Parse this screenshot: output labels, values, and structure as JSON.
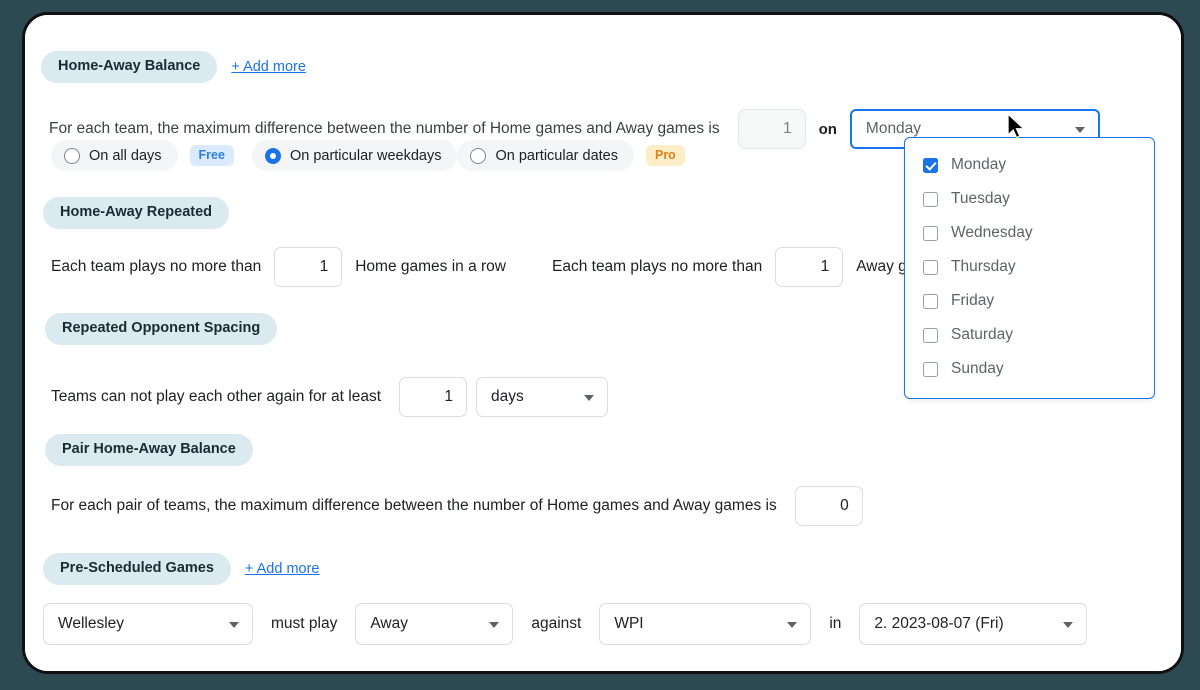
{
  "theme": {
    "page_background": "#2d4a52",
    "card_background": "#ffffff",
    "accent": "#1a73e8",
    "pill_background": "#dbe9f1",
    "free_badge_bg": "#dbeafe",
    "free_badge_fg": "#2f7fe0",
    "pro_badge_bg": "#fdeec8",
    "pro_badge_fg": "#e0801a"
  },
  "sections": {
    "home_away_balance": {
      "title": "Home-Away Balance",
      "add_more": "+ Add more",
      "sentence": "For each team, the maximum difference between the number of Home games and Away games is",
      "max_difference": "1",
      "on_label": "on",
      "weekday_select_value": "Monday",
      "options": [
        {
          "label": "On all days",
          "selected": false,
          "badge": "Free"
        },
        {
          "label": "On particular weekdays",
          "selected": true,
          "badge": ""
        },
        {
          "label": "On particular dates",
          "selected": false,
          "badge": "Pro"
        }
      ],
      "weekday_menu": {
        "open": true,
        "items": [
          {
            "label": "Monday",
            "checked": true
          },
          {
            "label": "Tuesday",
            "checked": false
          },
          {
            "label": "Wednesday",
            "checked": false
          },
          {
            "label": "Thursday",
            "checked": false
          },
          {
            "label": "Friday",
            "checked": false
          },
          {
            "label": "Saturday",
            "checked": false
          },
          {
            "label": "Sunday",
            "checked": false
          }
        ]
      }
    },
    "home_away_repeated": {
      "title": "Home-Away Repeated",
      "home_prefix": "Each team plays no more than",
      "home_value": "1",
      "home_suffix": "Home games in a row",
      "away_prefix": "Each team plays no more than",
      "away_value": "1",
      "away_suffix": "Away games in a row"
    },
    "repeated_opponent_spacing": {
      "title": "Repeated Opponent Spacing",
      "sentence": "Teams can not play each other again for at least",
      "value": "1",
      "unit": "days"
    },
    "pair_home_away_balance": {
      "title": "Pair Home-Away Balance",
      "sentence": "For each pair of teams, the maximum difference between the number of Home games and Away games is",
      "value": "0"
    },
    "pre_scheduled_games": {
      "title": "Pre-Scheduled Games",
      "add_more": "+ Add more",
      "team": "Wellesley",
      "must_play": "must play",
      "venue": "Away",
      "against": "against",
      "opponent": "WPI",
      "in_label": "in",
      "slot": "2. 2023-08-07 (Fri)"
    }
  }
}
